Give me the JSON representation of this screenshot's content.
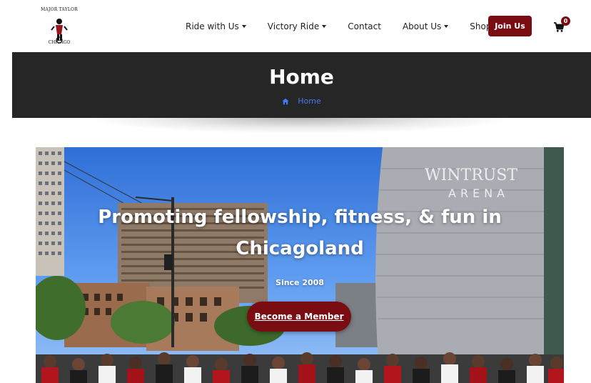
{
  "logo": {
    "top_text": "MAJOR TAYLOR",
    "bottom_text": "CHICAGO"
  },
  "nav": {
    "items": [
      {
        "label": "Ride with Us",
        "dropdown": true
      },
      {
        "label": "Victory Ride",
        "dropdown": true
      },
      {
        "label": "Contact",
        "dropdown": false
      },
      {
        "label": "About Us",
        "dropdown": true
      },
      {
        "label": "Shop",
        "dropdown": false
      }
    ],
    "join_label": "Join Us",
    "cart_count": "0"
  },
  "banner": {
    "title": "Home",
    "breadcrumb": "Home"
  },
  "hero": {
    "heading": "Promoting fellowship, fitness, & fun in Chicagoland",
    "since": "Since 2008",
    "button_label": "Become a Member",
    "sign_line1": "WINTRUST",
    "sign_line2": "ARENA"
  },
  "colors": {
    "brand": "#7a0d12",
    "banner_bg": "#262626",
    "link": "#3e7bf4"
  }
}
